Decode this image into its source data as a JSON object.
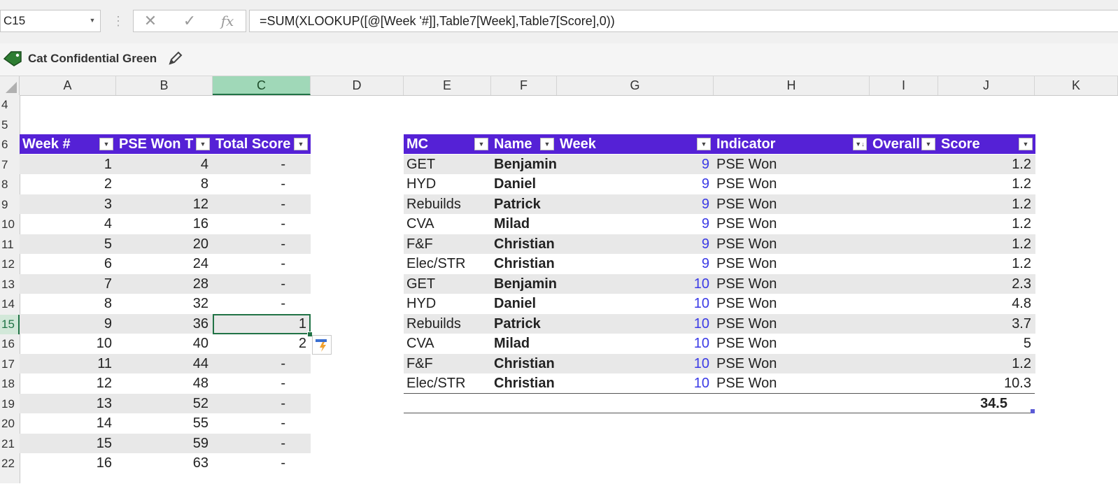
{
  "formula_bar": {
    "name_box": "C15",
    "formula": "=SUM(XLOOKUP([@[Week '#]],Table7[Week],Table7[Score],0))",
    "cancel_icon": "✕",
    "enter_icon": "✓",
    "fx_label": "fx"
  },
  "sensitivity": {
    "label": "Cat Confidential Green",
    "colors": {
      "tag": "#2e7d32"
    }
  },
  "columns": [
    "A",
    "B",
    "C",
    "D",
    "E",
    "F",
    "G",
    "H",
    "I",
    "J",
    "K"
  ],
  "selected_column": "C",
  "rows": [
    "4",
    "5",
    "6",
    "7",
    "8",
    "9",
    "10",
    "11",
    "12",
    "13",
    "14",
    "15",
    "16",
    "17",
    "18",
    "19",
    "20",
    "21",
    "22"
  ],
  "selected_row": "15",
  "left_table": {
    "headers": [
      "Week #",
      "PSE Won T",
      "Total Score"
    ],
    "rows": [
      [
        "1",
        "4",
        "-"
      ],
      [
        "2",
        "8",
        "-"
      ],
      [
        "3",
        "12",
        "-"
      ],
      [
        "4",
        "16",
        "-"
      ],
      [
        "5",
        "20",
        "-"
      ],
      [
        "6",
        "24",
        "-"
      ],
      [
        "7",
        "28",
        "-"
      ],
      [
        "8",
        "32",
        "-"
      ],
      [
        "9",
        "36",
        "1"
      ],
      [
        "10",
        "40",
        "2"
      ],
      [
        "11",
        "44",
        "-"
      ],
      [
        "12",
        "48",
        "-"
      ],
      [
        "13",
        "52",
        "-"
      ],
      [
        "14",
        "55",
        "-"
      ],
      [
        "15",
        "59",
        "-"
      ],
      [
        "16",
        "63",
        "-"
      ]
    ]
  },
  "right_table": {
    "headers": [
      "MC",
      "Name",
      "Week",
      "Indicator",
      "Overall",
      "Score"
    ],
    "rows": [
      [
        "GET",
        "Benjamin",
        "9",
        "PSE Won",
        "",
        "1.2"
      ],
      [
        "HYD",
        "Daniel",
        "9",
        "PSE Won",
        "",
        "1.2"
      ],
      [
        "Rebuilds",
        "Patrick",
        "9",
        "PSE Won",
        "",
        "1.2"
      ],
      [
        "CVA",
        "Milad",
        "9",
        "PSE Won",
        "",
        "1.2"
      ],
      [
        "F&F",
        "Christian",
        "9",
        "PSE Won",
        "",
        "1.2"
      ],
      [
        "Elec/STR",
        "Christian",
        "9",
        "PSE Won",
        "",
        "1.2"
      ],
      [
        "GET",
        "Benjamin",
        "10",
        "PSE Won",
        "",
        "2.3"
      ],
      [
        "HYD",
        "Daniel",
        "10",
        "PSE Won",
        "",
        "4.8"
      ],
      [
        "Rebuilds",
        "Patrick",
        "10",
        "PSE Won",
        "",
        "3.7"
      ],
      [
        "CVA",
        "Milad",
        "10",
        "PSE Won",
        "",
        "5"
      ],
      [
        "F&F",
        "Christian",
        "10",
        "PSE Won",
        "",
        "1.2"
      ],
      [
        "Elec/STR",
        "Christian",
        "10",
        "PSE Won",
        "",
        "10.3"
      ]
    ],
    "total": "34.5"
  },
  "colors": {
    "table_header": "#5521d6",
    "band": "#e8e8e8",
    "week_number": "#3b3be6",
    "selection": "#217346"
  }
}
